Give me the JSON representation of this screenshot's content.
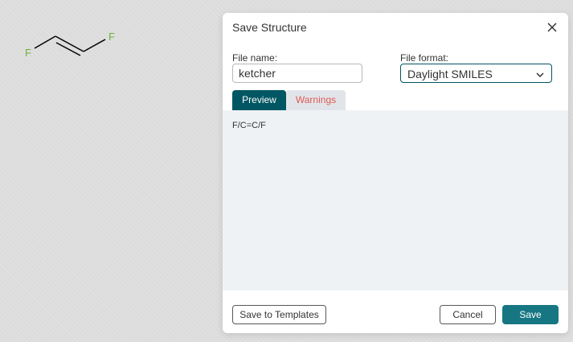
{
  "canvas": {
    "molecule": {
      "atoms": [
        {
          "element": "F",
          "color": "#6cb33f"
        },
        {
          "element": "F",
          "color": "#6cb33f"
        }
      ],
      "bond_color": "#000000"
    }
  },
  "dialog": {
    "title": "Save Structure",
    "close_icon": "close-icon",
    "file_name": {
      "label": "File name:",
      "value": "ketcher"
    },
    "file_format": {
      "label": "File format:",
      "selected": "Daylight SMILES"
    },
    "tabs": [
      {
        "label": "Preview",
        "active": true
      },
      {
        "label": "Warnings",
        "active": false
      }
    ],
    "preview": {
      "content": "F/C=C/F"
    },
    "buttons": {
      "save_to_templates": "Save to Templates",
      "cancel": "Cancel",
      "save": "Save"
    },
    "colors": {
      "accent": "#005662",
      "save_button": "#167782",
      "warning_text": "#e05a52"
    }
  }
}
